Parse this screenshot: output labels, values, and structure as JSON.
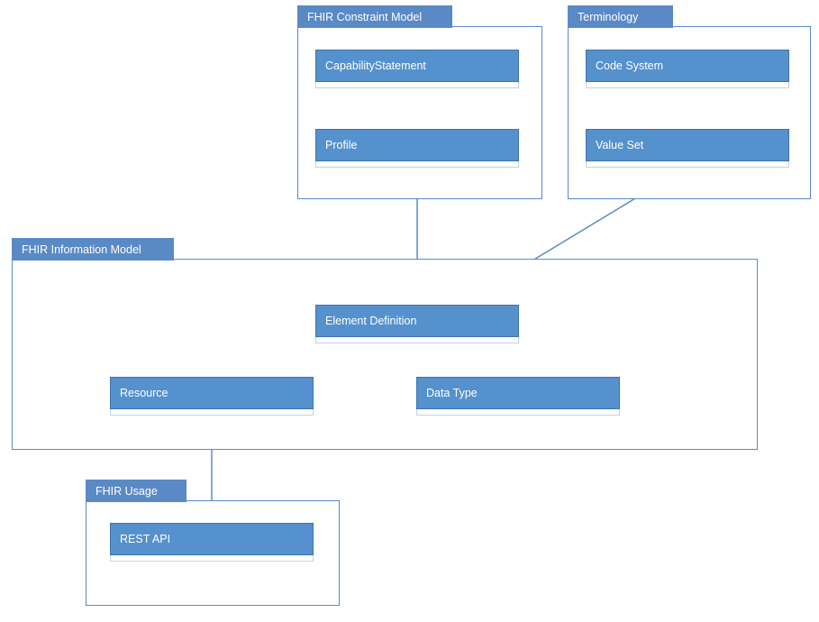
{
  "packages": {
    "constraint": {
      "title": "FHIR Constraint Model"
    },
    "terminology": {
      "title": "Terminology"
    },
    "info": {
      "title": "FHIR Information Model"
    },
    "usage": {
      "title": "FHIR Usage"
    }
  },
  "classes": {
    "capability_statement": {
      "label": "CapabilityStatement"
    },
    "profile": {
      "label": "Profile"
    },
    "code_system": {
      "label": "Code System"
    },
    "value_set": {
      "label": "Value Set"
    },
    "element_definition": {
      "label": "Element Definition"
    },
    "resource": {
      "label": "Resource"
    },
    "data_type": {
      "label": "Data Type"
    },
    "rest_api": {
      "label": "REST API"
    }
  },
  "colors": {
    "package_border": "#5a8ac6",
    "class_fill": "#5591cd",
    "class_border": "#3f73ad",
    "connector": "#5a8ac6"
  }
}
